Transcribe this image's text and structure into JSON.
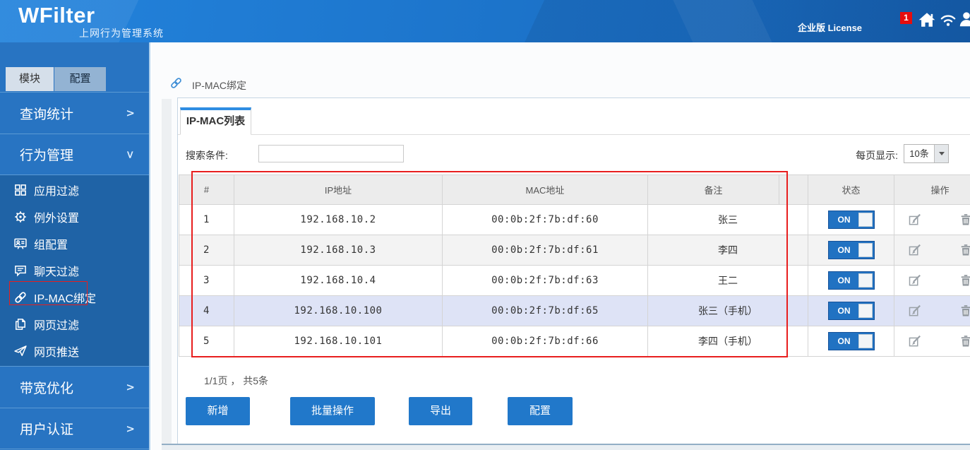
{
  "header": {
    "logo": "WFilter",
    "subtitle": "上网行为管理系统",
    "license": "企业版 License",
    "badge_count": "1",
    "icons": [
      "notification-badge",
      "home-icon",
      "wifi-icon",
      "user-icon"
    ]
  },
  "sidebar": {
    "tabs": [
      {
        "label": "模块",
        "active": true
      },
      {
        "label": "配置",
        "active": false
      }
    ],
    "sections_top": [
      {
        "label": "查询统计",
        "state": "collapsed"
      },
      {
        "label": "行为管理",
        "state": "expanded"
      }
    ],
    "submenu": [
      {
        "label": "应用过滤",
        "icon": "grid-icon"
      },
      {
        "label": "例外设置",
        "icon": "gear-icon"
      },
      {
        "label": "组配置",
        "icon": "group-icon"
      },
      {
        "label": "聊天过滤",
        "icon": "chat-icon"
      },
      {
        "label": "IP-MAC绑定",
        "icon": "link-icon",
        "selected": true
      },
      {
        "label": "网页过滤",
        "icon": "webpage-filter-icon"
      },
      {
        "label": "网页推送",
        "icon": "webpage-push-icon"
      }
    ],
    "sections_bottom": [
      {
        "label": "带宽优化",
        "state": "collapsed"
      },
      {
        "label": "用户认证",
        "state": "collapsed"
      }
    ]
  },
  "breadcrumb": {
    "title": "IP-MAC绑定"
  },
  "panel": {
    "tab_label": "IP-MAC列表",
    "search_label": "搜索条件:",
    "search_value": "",
    "per_page_label": "每页显示:",
    "per_page_value": "10条",
    "table": {
      "headers": [
        "#",
        "IP地址",
        "MAC地址",
        "备注",
        "",
        "状态",
        "操作"
      ],
      "rows": [
        {
          "index": "1",
          "ip": "192.168.10.2",
          "mac": "00:0b:2f:7b:df:60",
          "remark": "张三",
          "status": "ON",
          "highlighted": false
        },
        {
          "index": "2",
          "ip": "192.168.10.3",
          "mac": "00:0b:2f:7b:df:61",
          "remark": "李四",
          "status": "ON",
          "highlighted": false
        },
        {
          "index": "3",
          "ip": "192.168.10.4",
          "mac": "00:0b:2f:7b:df:63",
          "remark": "王二",
          "status": "ON",
          "highlighted": false
        },
        {
          "index": "4",
          "ip": "192.168.10.100",
          "mac": "00:0b:2f:7b:df:65",
          "remark": "张三（手机）",
          "status": "ON",
          "highlighted": true
        },
        {
          "index": "5",
          "ip": "192.168.10.101",
          "mac": "00:0b:2f:7b:df:66",
          "remark": "李四（手机）",
          "status": "ON",
          "highlighted": false
        }
      ]
    },
    "pagination": "1/1页 ， 共5条",
    "buttons": [
      "新增",
      "批量操作",
      "导出",
      "配置"
    ]
  },
  "colors": {
    "header_blue": "#1d76cd",
    "sidebar_blue": "#2874c2",
    "submenu_blue": "#1f63a6",
    "accent_button_blue": "#2178ca",
    "toggle_on_blue": "#2172c2",
    "row_highlight": "#dee3f6",
    "annotation_red": "#e81e1e"
  }
}
